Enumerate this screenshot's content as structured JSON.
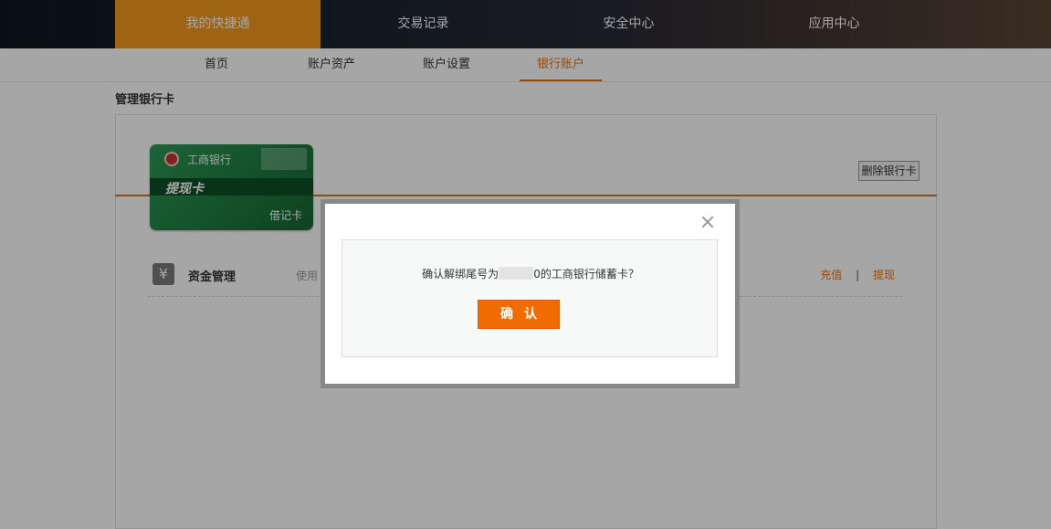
{
  "top_nav": {
    "items": [
      {
        "label": "我的快捷通",
        "active": true
      },
      {
        "label": "交易记录",
        "active": false
      },
      {
        "label": "安全中心",
        "active": false
      },
      {
        "label": "应用中心",
        "active": false
      }
    ]
  },
  "sub_nav": {
    "items": [
      {
        "label": "首页",
        "active": false
      },
      {
        "label": "账户资产",
        "active": false
      },
      {
        "label": "账户设置",
        "active": false
      },
      {
        "label": "银行账户",
        "active": true
      }
    ]
  },
  "section": {
    "title": "管理银行卡"
  },
  "card": {
    "bank_name": "工商银行",
    "card_label": "提现卡",
    "card_type": "借记卡",
    "bank_icon": "icbc-logo-icon"
  },
  "delete_button": {
    "label": "删除银行卡"
  },
  "fund": {
    "icon": "yen-icon",
    "title": "资金管理",
    "desc_prefix": "使用",
    "actions": {
      "recharge": "充值",
      "withdraw": "提现",
      "separator": "|"
    }
  },
  "modal": {
    "message_prefix": "确认解绑尾号为",
    "message_suffix": "0的工商银行储蓄卡？",
    "confirm_label": "确认",
    "close_icon": "close-icon"
  },
  "colors": {
    "accent": "#e8710a",
    "confirm": "#f06c00",
    "active_tab": "#f39a1e",
    "card_green": "#1d7a3f"
  }
}
